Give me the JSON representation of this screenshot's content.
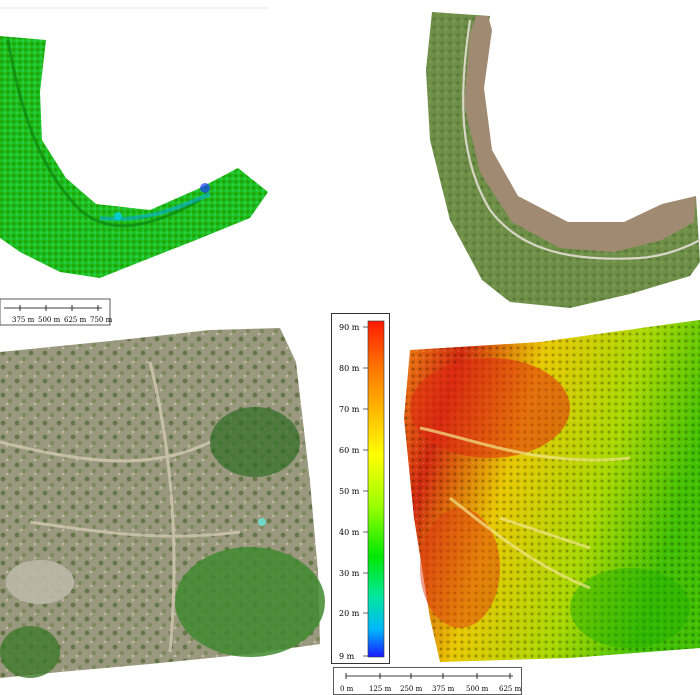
{
  "top_left_map": {
    "type": "elevation-dem-river-bend",
    "scale_bar": {
      "tick_labels": [
        "375 m",
        "500 m",
        "625 m",
        "750 m"
      ]
    }
  },
  "top_right_map": {
    "type": "orthophoto-river-bend"
  },
  "bottom_left_map": {
    "type": "orthophoto-quarry"
  },
  "bottom_right_map": {
    "type": "elevation-dem-quarry",
    "legend": {
      "tick_labels": [
        "90 m",
        "80 m",
        "70 m",
        "60 m",
        "50 m",
        "40 m",
        "30 m",
        "20 m",
        "9 m"
      ],
      "min_value": 9,
      "max_value": 92,
      "gradient_colors": [
        "#ff1a00",
        "#ff6a00",
        "#ffb000",
        "#ffff00",
        "#9bff00",
        "#00e800",
        "#00e8a0",
        "#00b4ff",
        "#1a1aff"
      ]
    },
    "scale_bar": {
      "tick_labels": [
        "0 m",
        "125 m",
        "250 m",
        "375 m",
        "500 m",
        "625 m"
      ]
    }
  }
}
